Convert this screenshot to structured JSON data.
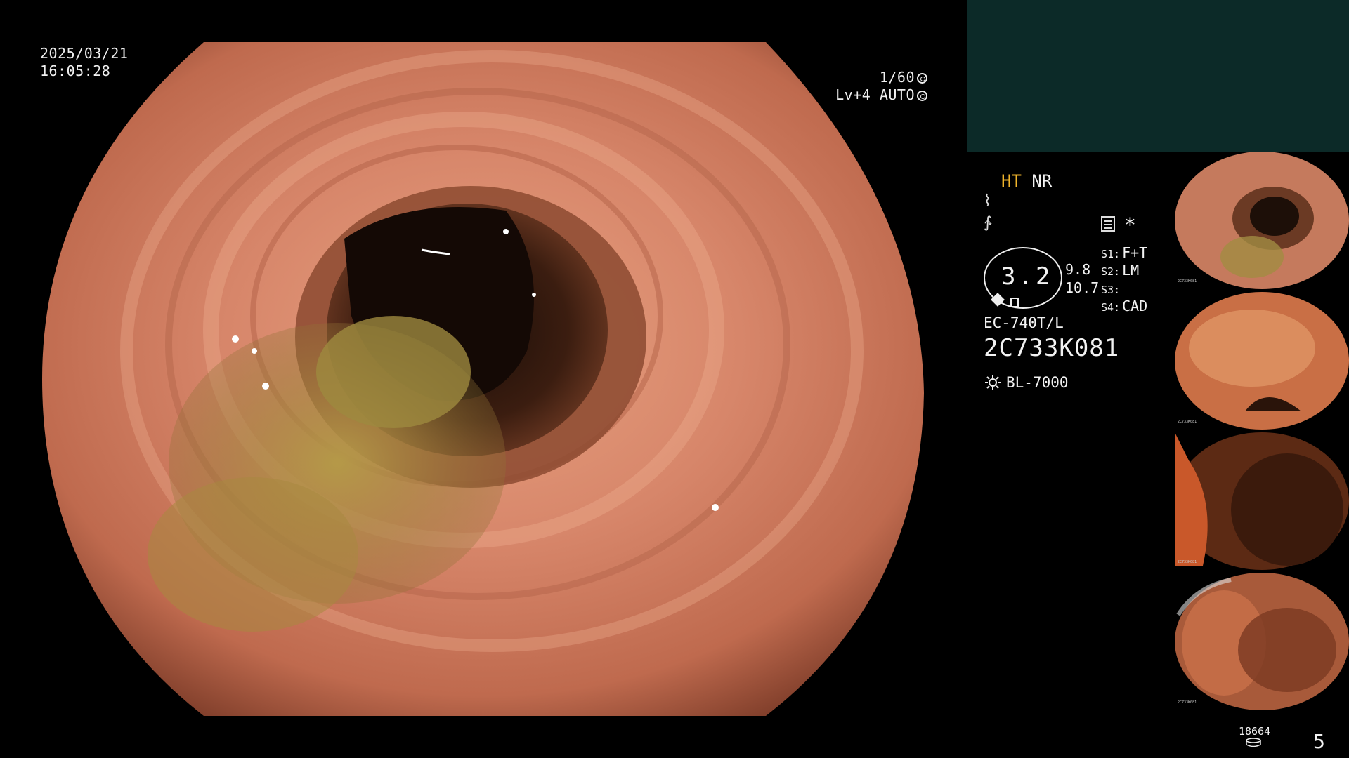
{
  "overlay": {
    "date": "2025/03/21",
    "time": "16:05:28",
    "shutter": "1/60",
    "level": "Lv+4",
    "mode": "AUTO"
  },
  "processor": {
    "enhancement_primary": "HT",
    "enhancement_secondary": "NR",
    "zoom_value": "3.2",
    "value_upper": "9.8",
    "value_lower": "10.7",
    "slots": [
      {
        "key": "S1:",
        "value": "F+T"
      },
      {
        "key": "S2:",
        "value": "LM"
      },
      {
        "key": "S3:",
        "value": ""
      },
      {
        "key": "S4:",
        "value": "CAD"
      }
    ],
    "asterisk": "*",
    "scope_model": "EC-740T/L",
    "scope_serial": "2C733K081",
    "light_source": "BL-7000"
  },
  "footer": {
    "image_count": "18664",
    "page_number": "5"
  },
  "thumbnails": [
    {
      "tiny_serial": "2C733K081"
    },
    {
      "tiny_serial": "2C733K081"
    },
    {
      "tiny_serial": "2C733K081"
    },
    {
      "tiny_serial": "2C733K081"
    }
  ],
  "colors": {
    "background": "#000000",
    "highlight_mode": "#f1b52b",
    "top_panel": "#0c2a28",
    "mucosa": "#c97a5f"
  },
  "icons": [
    "shutter-icon",
    "auto-iris-icon",
    "tilde-icon",
    "menu-icon",
    "light-icon",
    "storage-icon"
  ]
}
